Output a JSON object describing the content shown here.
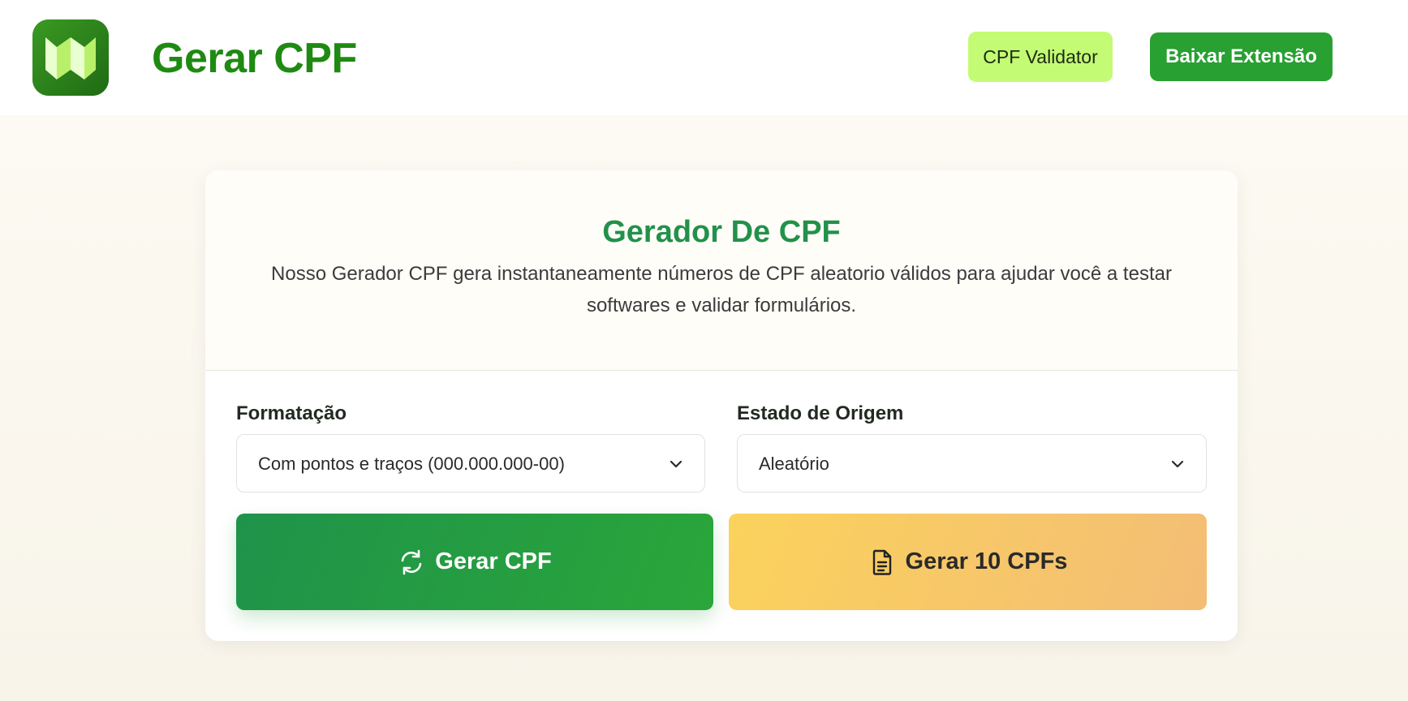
{
  "header": {
    "site_title": "Gerar CPF",
    "validator_label": "CPF Validator",
    "download_label": "Baixar Extensão"
  },
  "card": {
    "title": "Gerador De CPF",
    "description": "Nosso Gerador CPF gera instantaneamente números de CPF aleatorio válidos para ajudar você a testar softwares e validar formulários."
  },
  "form": {
    "format_label": "Formatação",
    "format_value": "Com pontos e traços (000.000.000-00)",
    "state_label": "Estado de Origem",
    "state_value": "Aleatório"
  },
  "actions": {
    "generate_label": "Gerar CPF",
    "generate_icon": "refresh-icon",
    "generate10_label": "Gerar 10 CPFs",
    "generate10_icon": "document-icon"
  },
  "colors": {
    "brand_green": "#1f8a12",
    "title_green": "#22914a",
    "validator_bg": "#c3fb74",
    "extension_bg": "#28a032",
    "generate_bg": "#2aa63a",
    "generate10_bg": "#fbd25c"
  }
}
